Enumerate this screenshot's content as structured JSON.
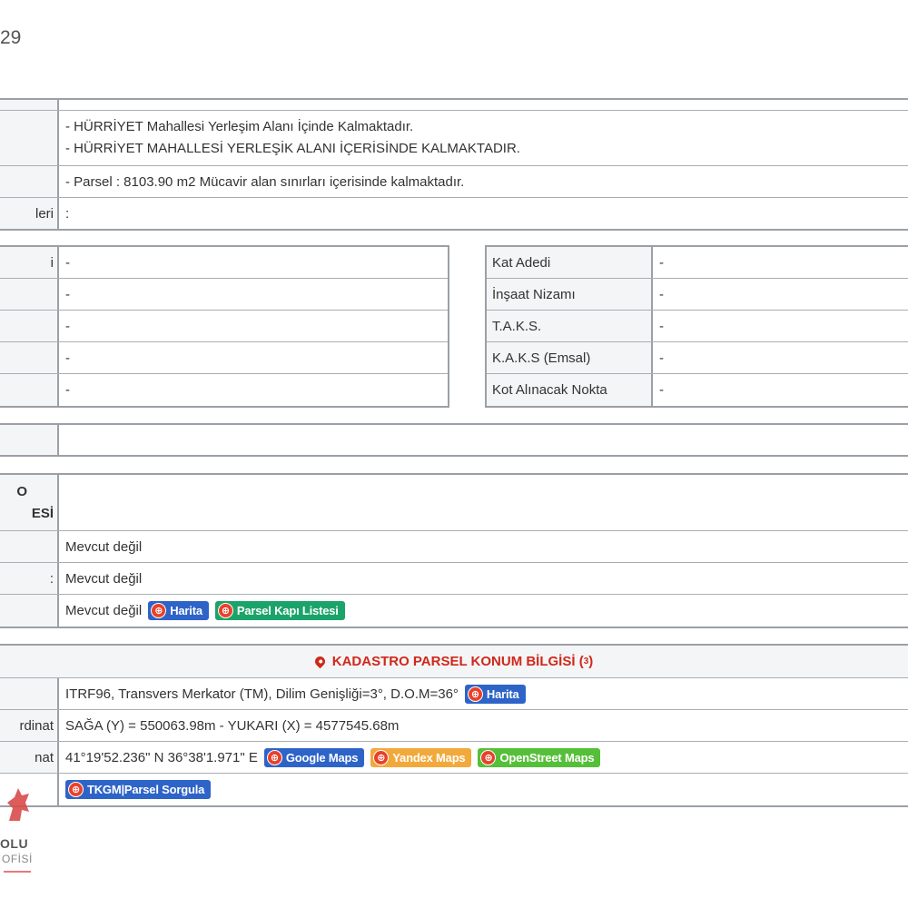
{
  "page_number": "29",
  "section1": {
    "rows": [
      {
        "label": "",
        "lines": []
      },
      {
        "label": "",
        "lines": [
          "- HÜRRİYET Mahallesi Yerleşim Alanı İçinde Kalmaktadır.",
          "- HÜRRİYET MAHALLESİ YERLEŞİK ALANI İÇERİSİNDE KALMAKTADIR."
        ]
      },
      {
        "label": "",
        "lines": [
          "- Parsel : 8103.90 m2 Mücavir alan sınırları içerisinde kalmaktadır."
        ]
      },
      {
        "label": "leri",
        "lines": [
          ":"
        ]
      }
    ]
  },
  "zoning_left": {
    "rows": [
      {
        "label": "i",
        "value": "-"
      },
      {
        "label": "",
        "value": "-"
      },
      {
        "label": "",
        "value": "-"
      },
      {
        "label": "",
        "value": "-"
      },
      {
        "label": "",
        "value": "-"
      }
    ]
  },
  "zoning_right": {
    "rows": [
      {
        "label": "Kat Adedi",
        "value": "-"
      },
      {
        "label": "İnşaat Nizamı",
        "value": "-"
      },
      {
        "label": "T.A.K.S.",
        "value": "-"
      },
      {
        "label": "K.A.K.S (Emsal)",
        "value": "-"
      },
      {
        "label": "Kot Alınacak Nokta",
        "value": "-"
      }
    ]
  },
  "section3": {
    "row1_label": "",
    "row1_value": ""
  },
  "section4": {
    "header_label_line1": "O",
    "header_label_line2": "ESİ",
    "rows": [
      {
        "label": "",
        "value": "Mevcut değil"
      },
      {
        "label": ":",
        "value": "Mevcut değil"
      },
      {
        "label": "",
        "value": "Mevcut değil"
      }
    ],
    "harita_button": "Harita",
    "parsel_kapi_button": "Parsel Kapı Listesi"
  },
  "kadastro": {
    "title": "KADASTRO PARSEL KONUM BİLGİSİ (",
    "title_sup": "3",
    "title_end": ")",
    "rows": [
      {
        "label": "",
        "value": "ITRF96, Transvers Merkator (TM), Dilim Genişliği=3°, D.O.M=36°"
      },
      {
        "label": "rdinat",
        "value": "SAĞA (Y) = 550063.98m - YUKARI (X) = 4577545.68m"
      },
      {
        "label": "nat",
        "value": "41°19'52.236\" N 36°38'1.971\" E"
      },
      {
        "label": "",
        "value": ""
      }
    ],
    "harita_button": "Harita",
    "google_maps_button": "Google Maps",
    "yandex_maps_button": "Yandex Maps",
    "openstreet_maps_button": "OpenStreet Maps",
    "tkgm_button": "TKGM|Parsel Sorgula"
  },
  "logo": {
    "text1": "OLU",
    "text2": "OFİSİ"
  },
  "colors": {
    "accent_red": "#d0281c",
    "button_blue": "#2e64c8",
    "button_green": "#1ba46a",
    "button_orange": "#f2a93b",
    "button_lime": "#56bf3a"
  }
}
